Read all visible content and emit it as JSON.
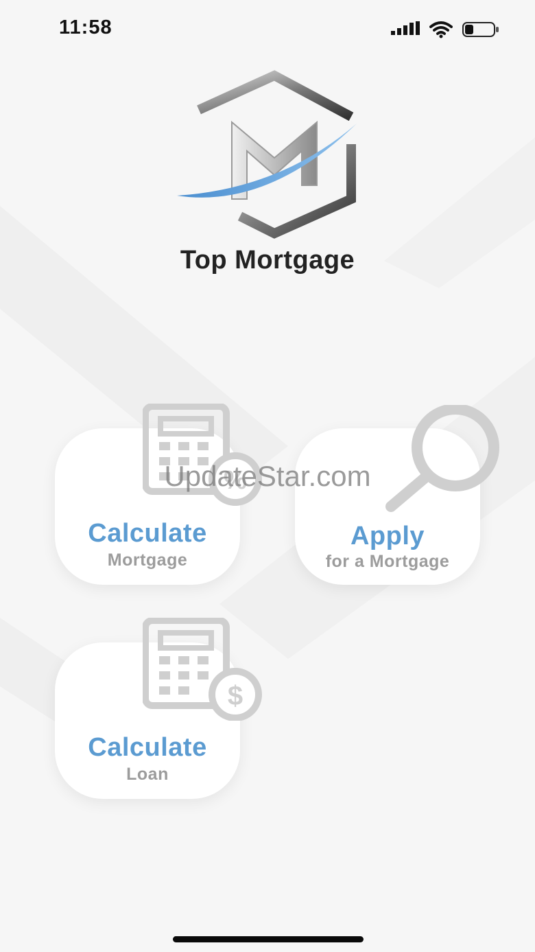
{
  "status_bar": {
    "time": "11:58"
  },
  "app": {
    "name": "Top Mortgage"
  },
  "tiles": [
    {
      "title": "Calculate",
      "subtitle": "Mortgage",
      "icon": "calculator-percent-icon"
    },
    {
      "title": "Apply",
      "subtitle": "for a Mortgage",
      "icon": "magnifier-icon"
    },
    {
      "title": "Calculate",
      "subtitle": "Loan",
      "icon": "calculator-dollar-icon"
    }
  ],
  "watermark": "UpdateStar.com",
  "colors": {
    "accent": "#5b9bd1",
    "subtitle": "#9c9c9c",
    "background": "#f6f6f6"
  }
}
